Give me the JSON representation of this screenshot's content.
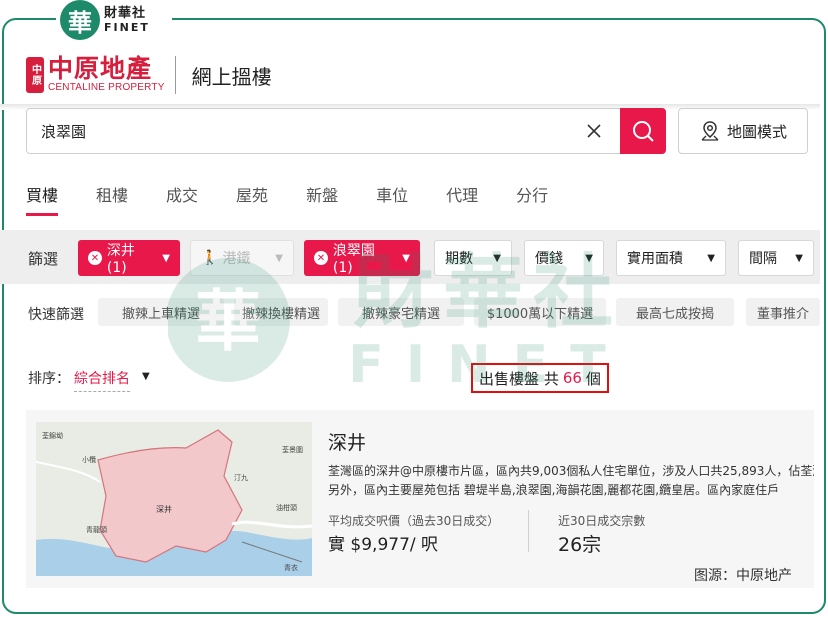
{
  "watermark": {
    "cn": "財華社",
    "en": "FINET",
    "badge_char": "華"
  },
  "header": {
    "logo_mark": "中原",
    "logo_cn": "中原地產",
    "logo_en": "CENTALINE PROPERTY",
    "title": "網上搵樓"
  },
  "search": {
    "value": "浪翠園",
    "map_mode_label": "地圖模式"
  },
  "tabs": [
    "買樓",
    "租樓",
    "成交",
    "屋苑",
    "新盤",
    "車位",
    "代理",
    "分行"
  ],
  "filters": {
    "label": "篩選",
    "region": "深井(1)",
    "mtr": "港鐵",
    "estate": "浪翠園(1)",
    "period": "期數",
    "price": "價錢",
    "area": "實用面積",
    "room": "間隔"
  },
  "quick": {
    "label": "快速篩選",
    "items": [
      "撤辣上車精選",
      "撤辣換樓精選",
      "撤辣豪宅精選",
      "$1000萬以下精選",
      "最高七成按揭",
      "董事推介"
    ]
  },
  "sort": {
    "label": "排序：",
    "value": "綜合排名"
  },
  "count": {
    "prefix": "出售樓盤 共",
    "value": "66",
    "suffix": "個"
  },
  "result": {
    "title": "深井",
    "desc_line1": "荃灣區的深井@中原樓市片區，區內共9,003個私人住宅單位，涉及人口共25,893人，佔荃灣",
    "desc_line2": "另外，區內主要屋苑包括 碧堤半島,浪翠園,海韻花園,麗都花園,纜皇居。區內家庭住戶",
    "avg_label": "平均成交呎價（過去30日成交）",
    "avg_value": "實 $9,977/ 呎",
    "deals_label": "近30日成交宗數",
    "deals_value": "26宗",
    "source": "图源：中原地产",
    "map_labels": {
      "l1": "荃錦坳",
      "l2": "小欖",
      "l3": "深井",
      "l4": "青龍頭",
      "l5": "汀九",
      "l6": "荃景圍",
      "l7": "油柑頭",
      "l8": "青衣"
    }
  },
  "colors": {
    "brand_red": "#e8194a",
    "frame_green": "#1e8a6a",
    "count_border": "#e01010"
  }
}
